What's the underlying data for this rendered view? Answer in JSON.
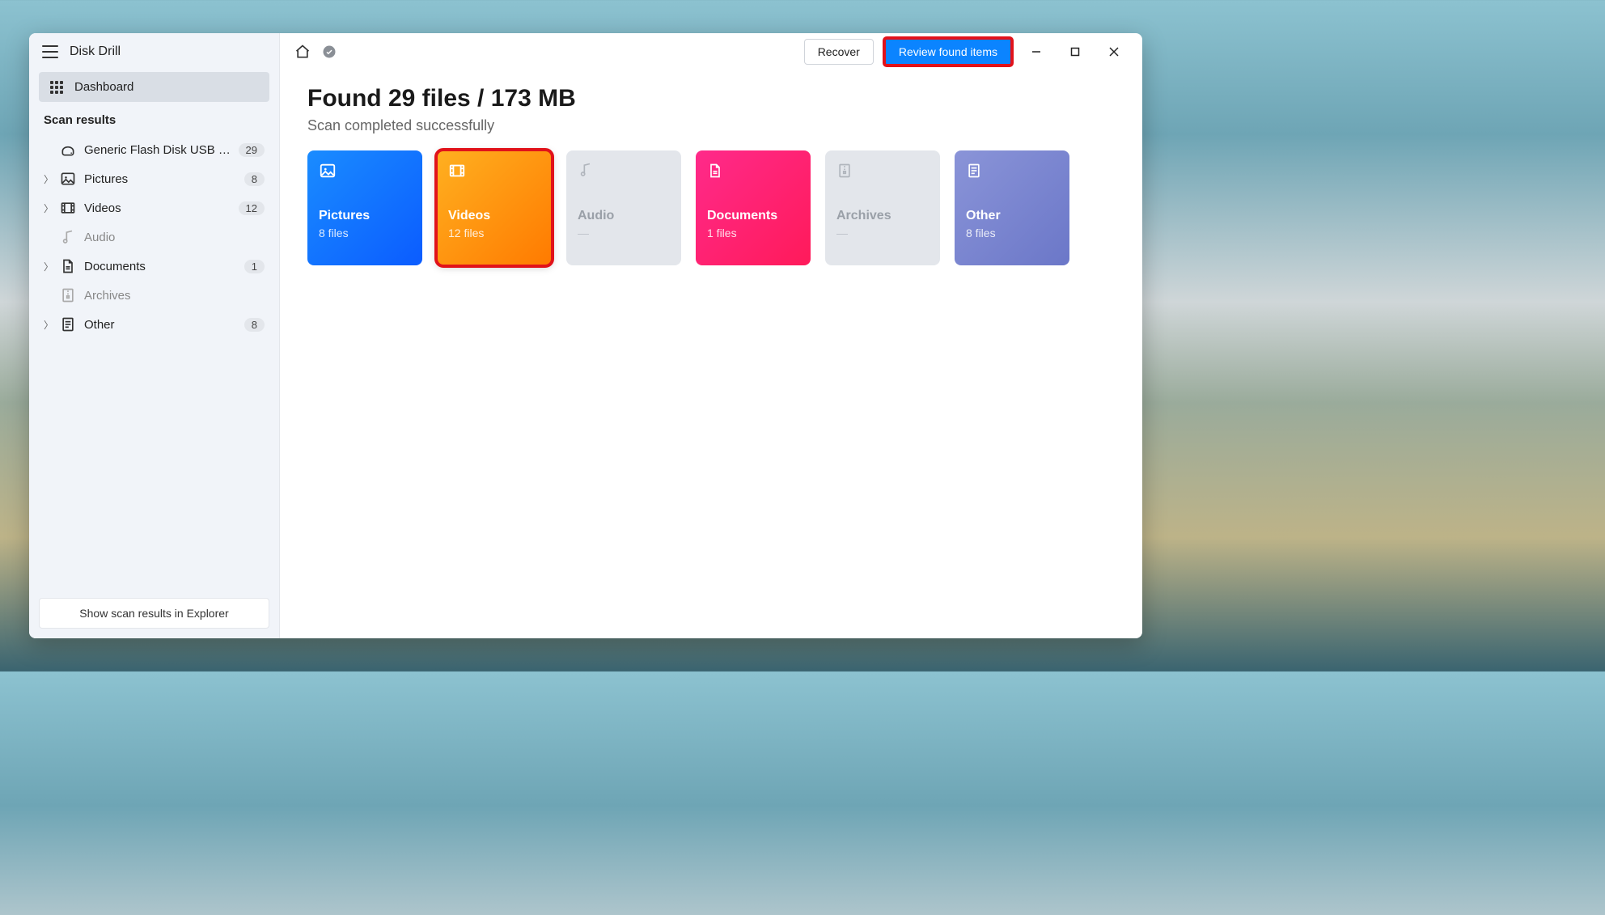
{
  "app": {
    "title": "Disk Drill"
  },
  "sidebar": {
    "dashboard": "Dashboard",
    "section": "Scan results",
    "items": [
      {
        "label": "Generic Flash Disk USB D…",
        "count": "29",
        "icon": "disk",
        "muted": false,
        "chev": false
      },
      {
        "label": "Pictures",
        "count": "8",
        "icon": "picture",
        "muted": false,
        "chev": true
      },
      {
        "label": "Videos",
        "count": "12",
        "icon": "video",
        "muted": false,
        "chev": true
      },
      {
        "label": "Audio",
        "count": "",
        "icon": "audio",
        "muted": true,
        "chev": false
      },
      {
        "label": "Documents",
        "count": "1",
        "icon": "document",
        "muted": false,
        "chev": true
      },
      {
        "label": "Archives",
        "count": "",
        "icon": "archive",
        "muted": true,
        "chev": false
      },
      {
        "label": "Other",
        "count": "8",
        "icon": "other",
        "muted": false,
        "chev": true
      }
    ],
    "bottom": "Show scan results in Explorer"
  },
  "topbar": {
    "recover": "Recover",
    "review": "Review found items"
  },
  "content": {
    "heading": "Found 29 files / 173 MB",
    "sub": "Scan completed successfully",
    "cards": [
      {
        "title": "Pictures",
        "sub": "8 files",
        "class": "c-pictures",
        "icon": "picture",
        "highlight": false,
        "disabled": false
      },
      {
        "title": "Videos",
        "sub": "12 files",
        "class": "c-videos",
        "icon": "video",
        "highlight": true,
        "disabled": false
      },
      {
        "title": "Audio",
        "sub": "—",
        "class": "",
        "icon": "audio",
        "highlight": false,
        "disabled": true
      },
      {
        "title": "Documents",
        "sub": "1 files",
        "class": "c-docs",
        "icon": "document",
        "highlight": false,
        "disabled": false
      },
      {
        "title": "Archives",
        "sub": "—",
        "class": "",
        "icon": "archive",
        "highlight": false,
        "disabled": true
      },
      {
        "title": "Other",
        "sub": "8 files",
        "class": "c-other",
        "icon": "other",
        "highlight": false,
        "disabled": false
      }
    ]
  }
}
